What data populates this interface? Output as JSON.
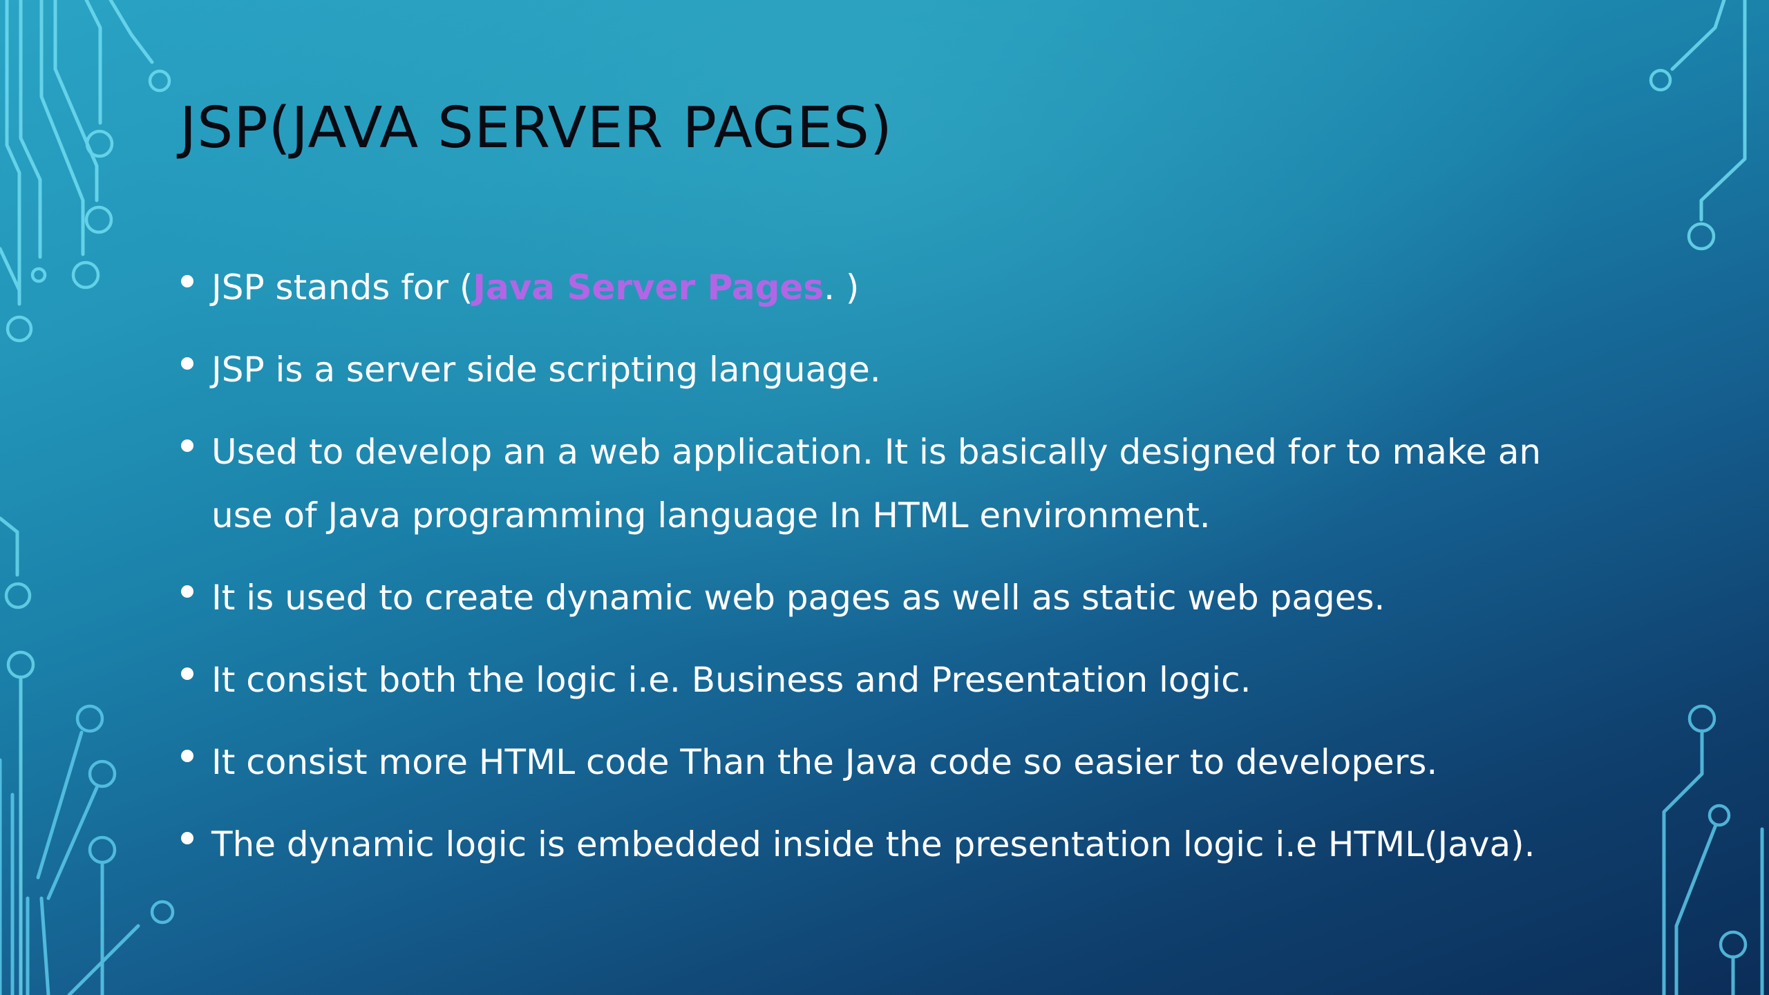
{
  "slide": {
    "title": "JSP(JAVA SERVER PAGES)",
    "bullets": [
      {
        "before": "JSP stands for (",
        "highlight": "Java Server Pages",
        "after": ". )"
      },
      {
        "text": "JSP is a server side scripting language."
      },
      {
        "text": "Used to develop an a web application. It is basically designed for to make an use of Java programming language In HTML environment."
      },
      {
        "text": "It is used to create dynamic web pages as well as static web pages."
      },
      {
        "text": "It consist both the logic i.e. Business and Presentation logic."
      },
      {
        "text": "It consist more HTML code Than the Java code so easier to developers."
      },
      {
        "text": "The dynamic logic is embedded inside the presentation logic i.e HTML(Java)."
      }
    ]
  },
  "theme": {
    "title_color": "#0a0a12",
    "text_color": "#ffffff",
    "highlight_color": "#b266e6",
    "circuit_color": "#5fd3ea"
  },
  "decoration": {
    "left_circuit_icon": "circuit-lines-icon",
    "right_circuit_icon": "circuit-lines-icon"
  }
}
